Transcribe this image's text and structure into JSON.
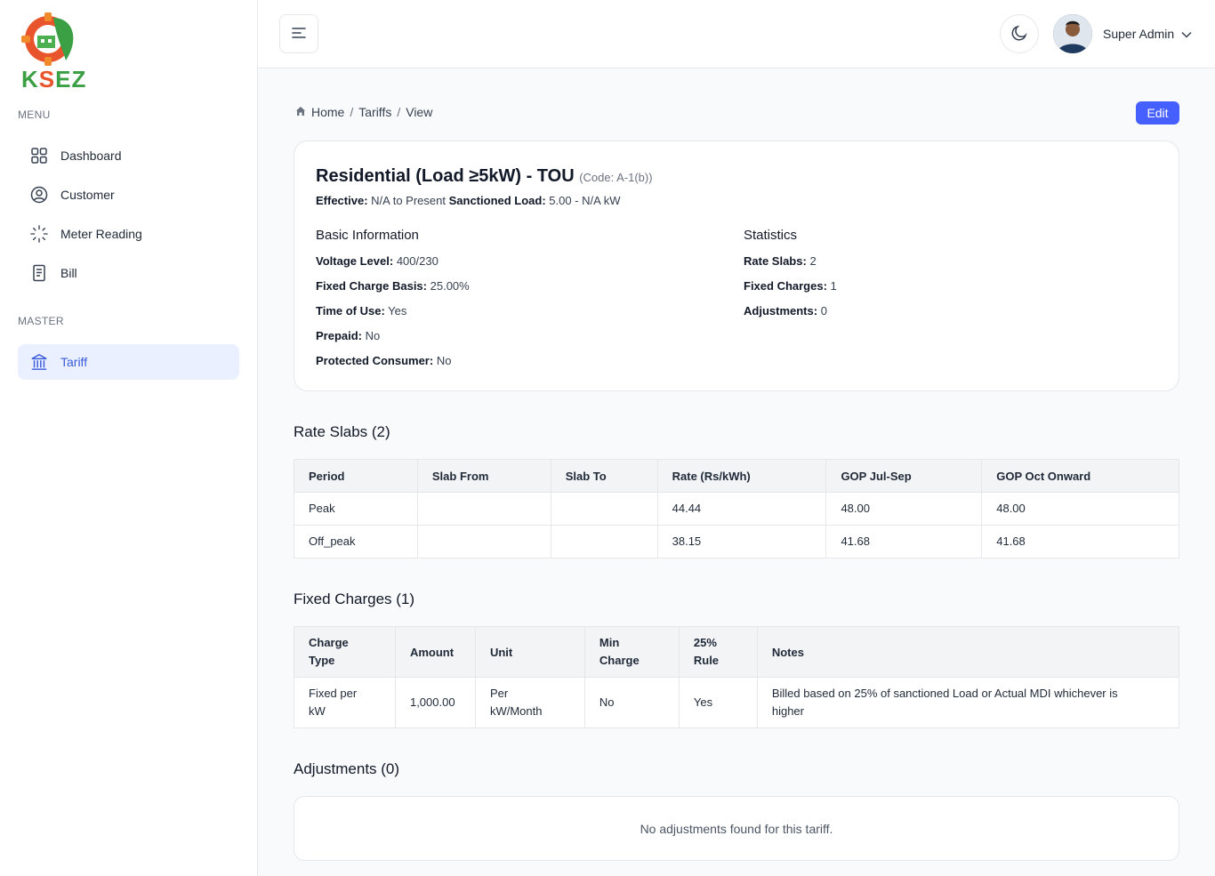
{
  "sidebar": {
    "logo_text": {
      "part1": "K",
      "part2": "S",
      "part3": "EZ"
    },
    "menu_label": "MENU",
    "items": [
      {
        "label": "Dashboard",
        "icon": "grid-icon"
      },
      {
        "label": "Customer",
        "icon": "user-circle-icon"
      },
      {
        "label": "Meter Reading",
        "icon": "loader-icon"
      },
      {
        "label": "Bill",
        "icon": "document-icon"
      }
    ],
    "master_label": "MASTER",
    "master_items": [
      {
        "label": "Tariff",
        "icon": "bank-icon",
        "active": true
      }
    ]
  },
  "header": {
    "user_name": "Super Admin"
  },
  "breadcrumb": {
    "home": "Home",
    "sep": "/",
    "tariffs": "Tariffs",
    "view": "View"
  },
  "edit_label": "Edit",
  "tariff": {
    "title": "Residential (Load ≥5kW) - TOU",
    "code": "(Code: A-1(b))",
    "effective_label": "Effective:",
    "effective_value": "N/A to Present",
    "sanctioned_label": "Sanctioned Load:",
    "sanctioned_value": "5.00 - N/A kW",
    "basic_info_title": "Basic Information",
    "basic_info": [
      {
        "label": "Voltage Level:",
        "value": "400/230"
      },
      {
        "label": "Fixed Charge Basis:",
        "value": "25.00%"
      },
      {
        "label": "Time of Use:",
        "value": "Yes"
      },
      {
        "label": "Prepaid:",
        "value": "No"
      },
      {
        "label": "Protected Consumer:",
        "value": "No"
      }
    ],
    "statistics_title": "Statistics",
    "statistics": [
      {
        "label": "Rate Slabs:",
        "value": "2"
      },
      {
        "label": "Fixed Charges:",
        "value": "1"
      },
      {
        "label": "Adjustments:",
        "value": "0"
      }
    ]
  },
  "rate_slabs": {
    "title": "Rate Slabs (2)",
    "headers": [
      "Period",
      "Slab From",
      "Slab To",
      "Rate (Rs/kWh)",
      "GOP Jul-Sep",
      "GOP Oct Onward"
    ],
    "rows": [
      [
        "Peak",
        "",
        "",
        "44.44",
        "48.00",
        "48.00"
      ],
      [
        "Off_peak",
        "",
        "",
        "38.15",
        "41.68",
        "41.68"
      ]
    ]
  },
  "fixed_charges": {
    "title": "Fixed Charges (1)",
    "headers": [
      "Charge Type",
      "Amount",
      "Unit",
      "Min Charge",
      "25% Rule",
      "Notes"
    ],
    "rows": [
      [
        "Fixed per kW",
        "1,000.00",
        "Per kW/Month",
        "No",
        "Yes",
        "Billed based on 25% of sanctioned Load or Actual MDI whichever is higher"
      ]
    ]
  },
  "adjustments": {
    "title": "Adjustments (0)",
    "empty_text": "No adjustments found for this tariff."
  },
  "colors": {
    "primary": "#465fff",
    "active_bg": "#eaf0ff",
    "active_text": "#3b5bdb"
  }
}
